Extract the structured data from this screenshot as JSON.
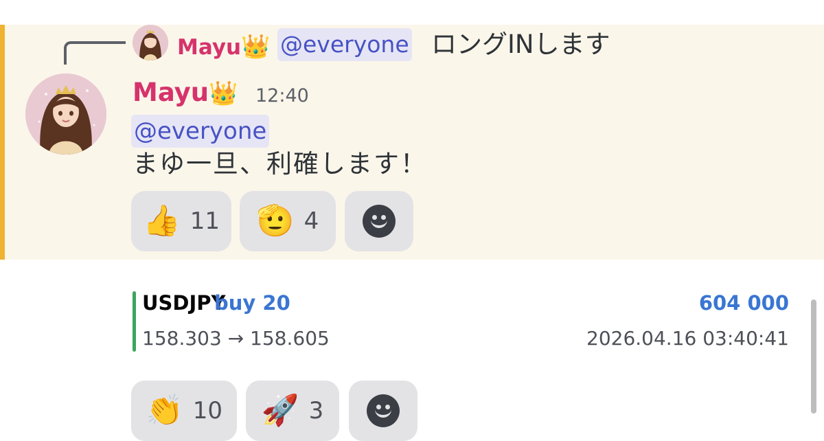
{
  "reply": {
    "name": "Mayu",
    "crown": "👑",
    "mention": "@everyone",
    "text": "ロングINします"
  },
  "message": {
    "author": "Mayu",
    "crown": "👑",
    "timestamp": "12:40",
    "mention": "@everyone",
    "text": "まゆ一旦、利確します！",
    "reactions": [
      {
        "emoji": "👍",
        "count": "11"
      },
      {
        "emoji": "🫡",
        "count": "4"
      }
    ]
  },
  "trade": {
    "symbol": "USDJPY",
    "side": "buy 20",
    "value": "604 000",
    "prices": "158.303 → 158.605",
    "datetime": "2026.04.16 03:40:41",
    "reactions": [
      {
        "emoji": "👏",
        "count": "10"
      },
      {
        "emoji": "🚀",
        "count": "3"
      }
    ]
  },
  "colors": {
    "highlight_bg": "#fbf6ea",
    "highlight_bar": "#f0b232",
    "username": "#d6336c",
    "mention_text": "#4752c4",
    "mention_bg": "#e6e5f5",
    "embed_bar": "#3ba55d",
    "accent_blue": "#3a76d1"
  },
  "icons": {
    "add_reaction": "smiley-icon",
    "reply_connector": "reply-spine-icon"
  }
}
